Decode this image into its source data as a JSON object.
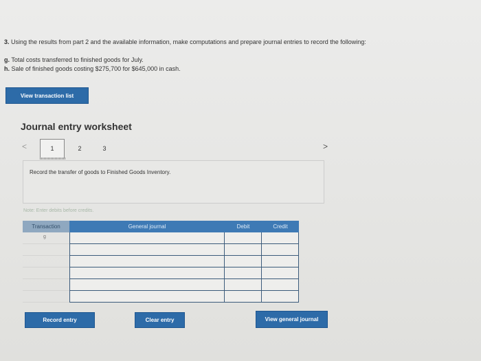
{
  "question": {
    "number": "3.",
    "text": "Using the results from part 2 and the available information, make computations and prepare journal entries to record the following:",
    "items": [
      {
        "letter": "g.",
        "text": "Total costs transferred to finished goods for July."
      },
      {
        "letter": "h.",
        "text": "Sale of finished goods costing $275,700 for $645,000 in cash."
      }
    ]
  },
  "buttons": {
    "view_transaction_list": "View transaction list",
    "record_entry": "Record entry",
    "clear_entry": "Clear entry",
    "view_general_journal": "View general journal"
  },
  "worksheet": {
    "title": "Journal entry worksheet",
    "nav_prev": "<",
    "nav_next": ">",
    "tabs": [
      "1",
      "2",
      "3"
    ],
    "instruction": "Record the transfer of goods to Finished Goods Inventory.",
    "note": "Note: Enter debits before credits."
  },
  "table": {
    "headers": {
      "transaction": "Transaction",
      "general_journal": "General journal",
      "debit": "Debit",
      "credit": "Credit"
    },
    "rows": [
      {
        "transaction": "g"
      },
      {
        "transaction": ""
      },
      {
        "transaction": ""
      },
      {
        "transaction": ""
      },
      {
        "transaction": ""
      },
      {
        "transaction": ""
      }
    ]
  }
}
